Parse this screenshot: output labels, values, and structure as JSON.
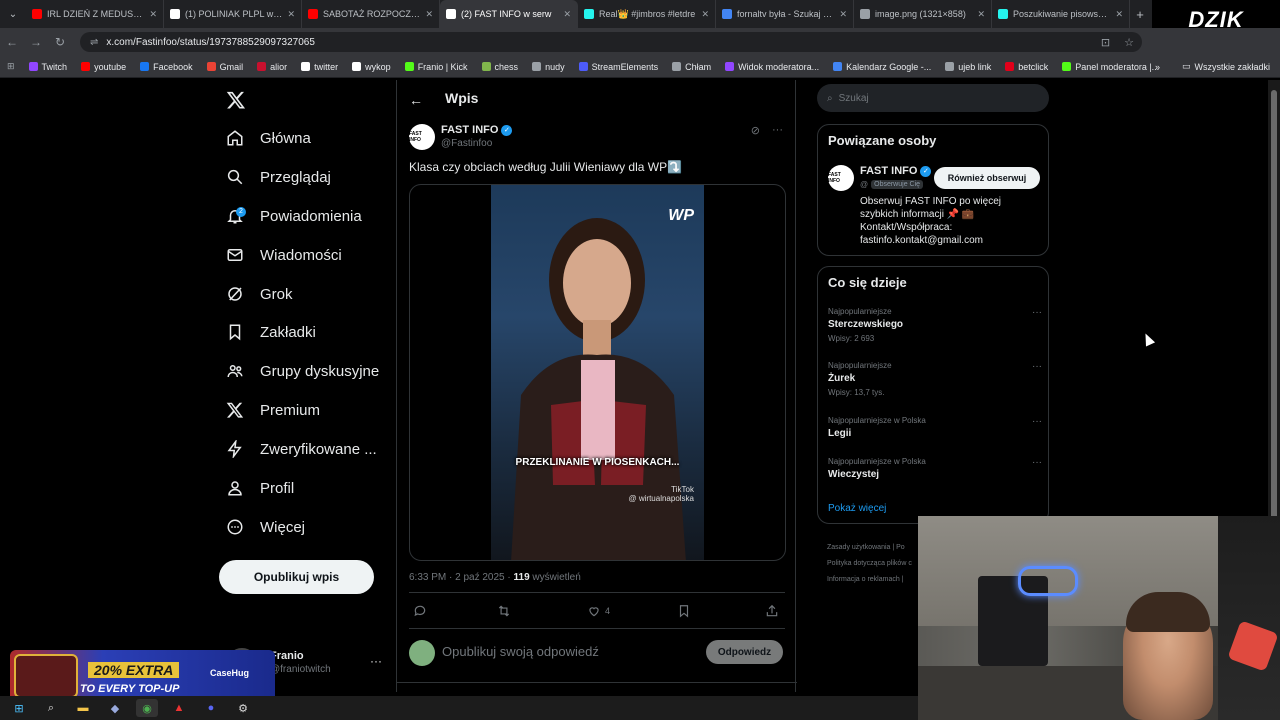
{
  "browser": {
    "tabs": [
      {
        "title": "IRL DZIEŃ Z MEDUSKAJ 2",
        "color": "#ff0000",
        "active": false
      },
      {
        "title": "(1) POLINIAK PLPL w serw",
        "color": "#ffffff",
        "active": false
      },
      {
        "title": "SABOTAŻ ROZPOCZĘTY! S",
        "color": "#ff0000",
        "active": false
      },
      {
        "title": "(2) FAST INFO w serw",
        "color": "#ffffff",
        "active": true
      },
      {
        "title": "Real👑 #jimbros #letdre",
        "color": "#25f4ee",
        "active": false
      },
      {
        "title": "fornaltv była - Szukaj w G",
        "color": "#4285f4",
        "active": false
      },
      {
        "title": "image.png (1321×858)",
        "color": "#9aa0a6",
        "active": false
      },
      {
        "title": "Poszukiwanie pisowskieg",
        "color": "#25f4ee",
        "active": false
      }
    ],
    "new_tab": "+",
    "url": "x.com/Fastinfoo/status/1973788529097327065",
    "bookmarks": [
      {
        "label": "Twitch",
        "color": "#9146ff"
      },
      {
        "label": "youtube",
        "color": "#ff0000"
      },
      {
        "label": "Facebook",
        "color": "#1877f2"
      },
      {
        "label": "Gmail",
        "color": "#ea4335"
      },
      {
        "label": "alior",
        "color": "#c8102e"
      },
      {
        "label": "twitter",
        "color": "#ffffff"
      },
      {
        "label": "wykop",
        "color": "#ffffff"
      },
      {
        "label": "Franio | Kick",
        "color": "#53fc18"
      },
      {
        "label": "chess",
        "color": "#81b64c"
      },
      {
        "label": "nudy",
        "color": "#9aa0a6"
      },
      {
        "label": "StreamElements",
        "color": "#4d5bf9"
      },
      {
        "label": "Chłam",
        "color": "#9aa0a6"
      },
      {
        "label": "Widok moderatora...",
        "color": "#9146ff"
      },
      {
        "label": "Kalendarz Google -...",
        "color": "#4285f4"
      },
      {
        "label": "ujeb link",
        "color": "#9aa0a6"
      },
      {
        "label": "betclick",
        "color": "#e2001a"
      },
      {
        "label": "Panel moderatora |...",
        "color": "#53fc18"
      }
    ],
    "all_bookmarks": "Wszystkie zakładki"
  },
  "overlay": {
    "brand": "DZIK",
    "promo_line1": "20% EXTRA",
    "promo_line2": "TO EVERY TOP-UP",
    "promo_brand": "CaseHug"
  },
  "sidebar": {
    "items": [
      {
        "label": "Główna",
        "icon": "home-icon"
      },
      {
        "label": "Przeglądaj",
        "icon": "search-icon"
      },
      {
        "label": "Powiadomienia",
        "icon": "bell-icon",
        "badge": "2"
      },
      {
        "label": "Wiadomości",
        "icon": "mail-icon"
      },
      {
        "label": "Grok",
        "icon": "grok-icon"
      },
      {
        "label": "Zakładki",
        "icon": "bookmark-icon"
      },
      {
        "label": "Grupy dyskusyjne",
        "icon": "communities-icon"
      },
      {
        "label": "Premium",
        "icon": "x-icon"
      },
      {
        "label": "Zweryfikowane ...",
        "icon": "lightning-icon"
      },
      {
        "label": "Profil",
        "icon": "profile-icon"
      },
      {
        "label": "Więcej",
        "icon": "more-icon"
      }
    ],
    "post_button": "Opublikuj wpis",
    "profile_name": "Franio",
    "profile_handle": "@franiotwitch",
    "profile_more": "···"
  },
  "main": {
    "header_title": "Wpis",
    "author_name": "FAST INFO",
    "author_handle": "@Fastinfoo",
    "author_avatar_text": "FAST INFO",
    "post_text": "Klasa czy obciach według Julii Wieniawy dla WP⤵️",
    "video_caption": "PRZEKLINANIE W PIOSENKACH...",
    "video_logo": "WP",
    "video_watermark": "TikTok",
    "video_watermark_handle": "@ wirtualnapolska",
    "post_time": "6:33 PM · 2 paź 2025 · ",
    "post_views_count": "119",
    "post_views_label": " wyświetleń",
    "likes_count": "4",
    "reply_placeholder": "Opublikuj swoją odpowiedź",
    "reply_button": "Odpowiedz"
  },
  "right": {
    "search_placeholder": "Szukaj",
    "related_title": "Powiązane osoby",
    "related_name": "FAST INFO",
    "related_handle": "@",
    "related_follows_you": "Obserwuje Cię",
    "related_follow_button": "Również obserwuj",
    "related_bio_1": "Obserwuj FAST INFO po więcej szybkich informacji 📌 💼",
    "related_bio_2": "Kontakt/Współpraca:",
    "related_bio_3": "fastinfo.kontakt@gmail.com",
    "trends_title": "Co się dzieje",
    "trends": [
      {
        "context": "Najpopularniejsze",
        "name": "Sterczewskiego",
        "count": "Wpisy: 2 693"
      },
      {
        "context": "Najpopularniejsze",
        "name": "Żurek",
        "count": "Wpisy: 13,7 tys."
      },
      {
        "context": "Najpopularniejsze w Polska",
        "name": "Legii",
        "count": ""
      },
      {
        "context": "Najpopularniejsze w Polska",
        "name": "Wieczystej",
        "count": ""
      }
    ],
    "show_more": "Pokaż więcej",
    "footer": [
      "Zasady użytkowania | Po",
      "Polityka dotycząca plików c",
      "Informacja o reklamach |"
    ]
  }
}
